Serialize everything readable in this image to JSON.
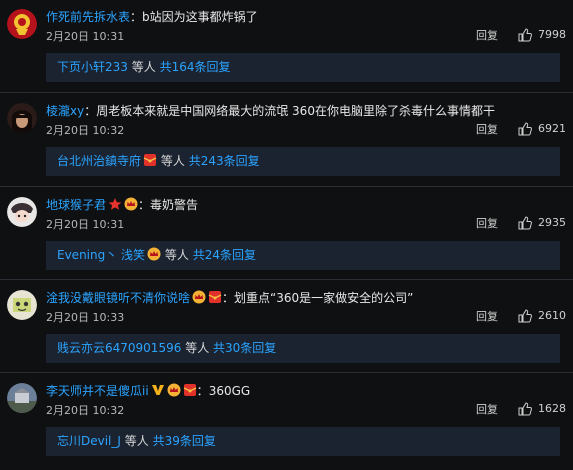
{
  "comments": [
    {
      "username": "作死前先拆水表",
      "text": "b站因为这事都炸锅了",
      "time": "2月20日 10:31",
      "reply_label": "回复",
      "likes": "7998",
      "sub_user": "下页小轩233",
      "sub_mid": "等人",
      "sub_count": "共164条回复"
    },
    {
      "username": "棱瀧xy",
      "text": "周老板本来就是中国网络最大的流氓 360在你电脑里除了杀毒什么事情都干",
      "time": "2月20日 10:32",
      "reply_label": "回复",
      "likes": "6921",
      "sub_user": "台北州治鎮寺府",
      "sub_mid": "等人",
      "sub_count": "共243条回复"
    },
    {
      "username": "地球猴子君",
      "text": "毒奶警告",
      "time": "2月20日 10:31",
      "reply_label": "回复",
      "likes": "2935",
      "sub_user": "Evening丶 浅笑",
      "sub_mid": "等人",
      "sub_count": "共24条回复"
    },
    {
      "username": "淦我没戴眼镜听不清你说啥",
      "text": "划重点“360是一家做安全的公司”",
      "time": "2月20日 10:33",
      "reply_label": "回复",
      "likes": "2610",
      "sub_user": "贱云亦云6470901596",
      "sub_mid": "等人",
      "sub_count": "共30条回复"
    },
    {
      "username": "李天师并不是傻瓜ii",
      "text": "360GG",
      "time": "2月20日 10:32",
      "reply_label": "回复",
      "likes": "1628",
      "sub_user": "忘川Devil_J",
      "sub_mid": "等人",
      "sub_count": "共39条回复"
    }
  ],
  "colors": {
    "background": "#0f1012",
    "username": "#2ba4ff",
    "subbox": "#1b2330",
    "text": "#e8e8e8"
  },
  "icons": [
    "thumbs-up-icon",
    "crown-badge-icon",
    "red-packet-badge-icon",
    "star-badge-icon",
    "v-badge-icon"
  ]
}
